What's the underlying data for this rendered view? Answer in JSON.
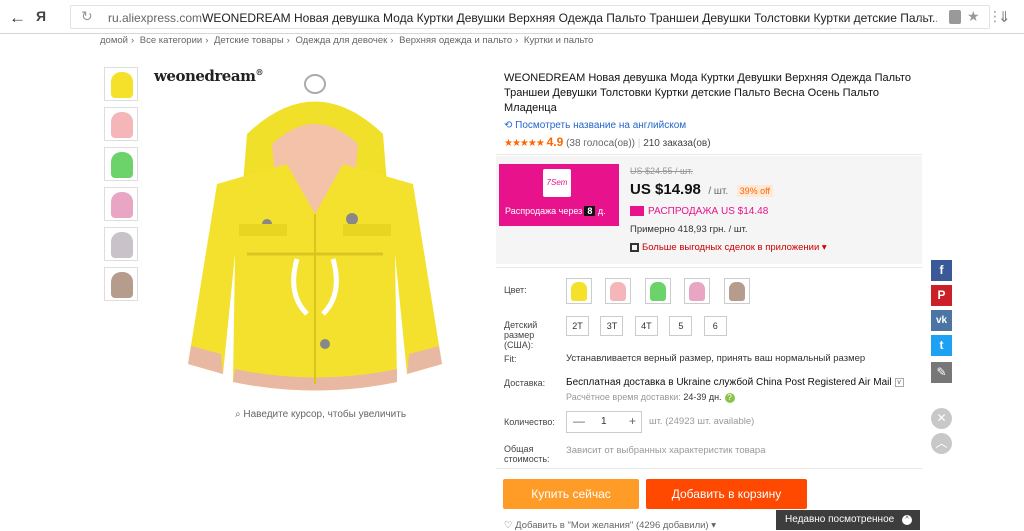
{
  "browser": {
    "back_icon": "←",
    "brand_glyph": "Я",
    "domain": "ru.aliexpress.com",
    "tab_title": "WEONEDREAM Новая девушка Мода Куртки Девушки Верхняя Одежда Пальто Траншеи Девушки Толстовки Куртки детские Пальт..."
  },
  "breadcrumb": [
    "домой",
    "Все категории",
    "Детские товары",
    "Одежда для девочек",
    "Верхняя одежда и пальто",
    "Куртки и пальто"
  ],
  "gallery": {
    "logo": "weonedream",
    "logo_mark": "®",
    "zoom_hint": "Наведите курсор, чтобы увеличить",
    "thumb_colors": [
      "#f5e02a",
      "#f4b6b8",
      "#6bd36a",
      "#e9a6c4",
      "#c9c2c8",
      "#b59c8c"
    ]
  },
  "product": {
    "title": "WEONEDREAM Новая девушка Мода Куртки Девушки Верхняя Одежда Пальто Траншеи Девушки Толстовки Куртки детские Пальто Весна Осень Пальто Младенца",
    "translate_link": "Посмотреть название на английском",
    "stars": "★★★★★",
    "rating": "4.9",
    "votes": "(38 голоса(ов))",
    "orders": "210 заказа(ов)"
  },
  "pricing": {
    "banner_logo": "7Sem",
    "banner_text": "Распродажа через",
    "banner_timer": "8",
    "banner_unit": "д.",
    "old_price": "US $24.55 / шт.",
    "price": "US $14.98",
    "per": "/ шт.",
    "discount": "39% off",
    "sale_label": "РАСПРОДАЖА US $14.48",
    "approx": "Примерно 418,93 грн. / шт.",
    "app_deals": "Больше выгодных сделок в приложении ▾"
  },
  "options": {
    "color_label": "Цвет:",
    "colors": [
      "#f5e02a",
      "#f4b6b8",
      "#6bd36a",
      "#e9a6c4",
      "#b59c8c"
    ],
    "size_label_1": "Детский",
    "size_label_2": "размер",
    "size_label_3": "(США):",
    "sizes": [
      "2T",
      "3T",
      "4T",
      "5",
      "6"
    ],
    "fit_label": "Fit:",
    "fit_text": "Устанавливается верный размер, принять ваш нормальный размер",
    "shipping_label": "Доставка:",
    "shipping_text": "Бесплатная доставка в Ukraine службой China Post Registered Air Mail",
    "shipping_time_label": "Расчётное время доставки:",
    "shipping_time": "24-39 дн.",
    "qty_label": "Количество:",
    "qty_value": "1",
    "availability": "шт. (24923 шт. available)",
    "total_label_1": "Общая",
    "total_label_2": "стоимость:",
    "total_text": "Зависит от выбранных характеристик товара"
  },
  "actions": {
    "buy_now": "Купить сейчас",
    "add_to_cart": "Добавить в корзину",
    "wishlist": "♡ Добавить в \"Мои желания\" (4296 добавили) ▾"
  },
  "share": {
    "facebook": "f",
    "pinterest": "P",
    "vk": "vk",
    "twitter": "t",
    "edit": "✎",
    "facebook_color": "#3b5998",
    "pinterest_color": "#cb2027",
    "vk_color": "#4c75a3",
    "twitter_color": "#1da1f2",
    "edit_color": "#777777"
  },
  "recently_viewed": "Недавно посмотренное"
}
